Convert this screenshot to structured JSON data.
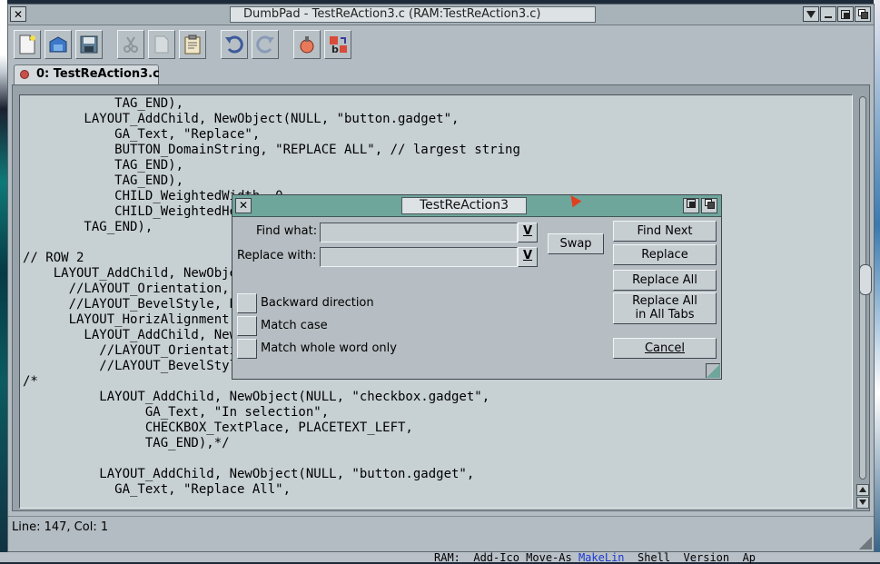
{
  "window": {
    "title": "DumbPad - TestReAction3.c (RAM:TestReAction3.c)",
    "close_glyph": "✕"
  },
  "toolbar": {
    "icons": [
      "new-document-icon",
      "open-icon",
      "save-icon",
      "cut-icon",
      "copy-icon",
      "paste-icon",
      "undo-icon",
      "redo-icon",
      "bookmark-icon",
      "replace-icon"
    ]
  },
  "tab": {
    "label": "0: TestReAction3.c"
  },
  "editor": {
    "lines": [
      "            TAG_END),",
      "        LAYOUT_AddChild, NewObject(NULL, \"button.gadget\",",
      "            GA_Text, \"Replace\",",
      "            BUTTON_DomainString, \"REPLACE ALL\", // largest string",
      "            TAG_END),",
      "            TAG_END),",
      "            CHILD_WeightedWidth, 0,",
      "            CHILD_WeightedHeight, 0,",
      "        TAG_END),",
      "",
      "// ROW 2",
      "    LAYOUT_AddChild, NewObject(NULL, \"layout.gadget\",",
      "      //LAYOUT_Orientation, LAYOUT_HORIZONTAL,",
      "      //LAYOUT_BevelStyle, BVS_GROUP,",
      "      LAYOUT_HorizAlignment, LALIGN_LEFT,",
      "        LAYOUT_AddChild, NewObject(NULL, \"layout.gadget\",",
      "          //LAYOUT_Orientation, LAYOUT_VERTICAL,",
      "          //LAYOUT_BevelStyle, BVS_GROUP,",
      "/*",
      "          LAYOUT_AddChild, NewObject(NULL, \"checkbox.gadget\",",
      "                GA_Text, \"In selection\",",
      "                CHECKBOX_TextPlace, PLACETEXT_LEFT,",
      "                TAG_END),*/",
      "",
      "          LAYOUT_AddChild, NewObject(NULL, \"button.gadget\",",
      "            GA_Text, \"Replace All\","
    ]
  },
  "status": {
    "text": "Line: 147, Col: 1"
  },
  "desktop": {
    "shell_prefix": "RAM:  Add-Ico Move-As ",
    "shell_highlight": "MakeLin",
    "shell_suffix": "  Shell  Version  Ap"
  },
  "dialog": {
    "title": "TestReAction3",
    "close_glyph": "✕",
    "find_label": "Find what:",
    "find_value": "",
    "replace_label": "Replace with:",
    "replace_value": "",
    "dropdown_glyph": "V",
    "swap_label": "Swap",
    "find_next_label": "Find Next",
    "replace_label_btn": "Replace",
    "replace_all_label": "Replace All",
    "replace_all_tabs_label": "Replace All\nin All Tabs",
    "cancel_label": "Cancel",
    "backward_label": "Backward direction",
    "match_case_label": "Match case",
    "whole_word_label": "Match whole word only",
    "backward_checked": false,
    "match_case_checked": false,
    "whole_word_checked": false
  }
}
